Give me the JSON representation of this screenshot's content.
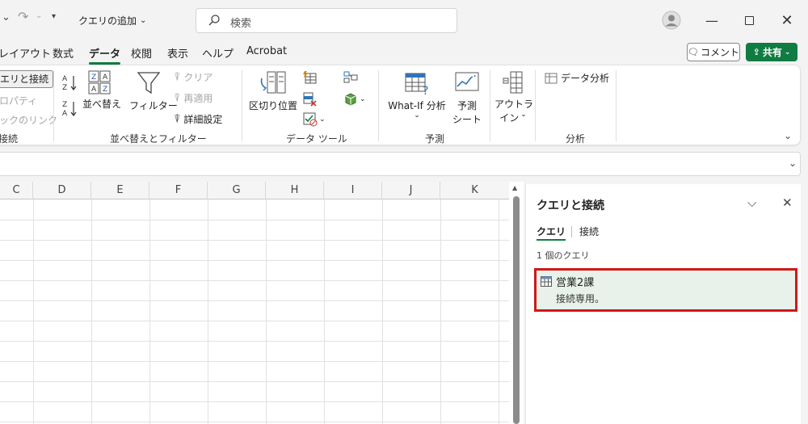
{
  "titlebar": {
    "doc_title": "クエリの追加",
    "search_placeholder": "検索"
  },
  "menu": {
    "tabs": [
      "レイアウト",
      "数式",
      "データ",
      "校閲",
      "表示",
      "ヘルプ",
      "Acrobat"
    ],
    "active_tab": "データ",
    "comment_label": "コメント",
    "share_label": "共有"
  },
  "ribbon": {
    "queries_group": {
      "label": "接続",
      "items": [
        "エリと接続",
        "ロパティ",
        "ックのリンク"
      ]
    },
    "sort_group": {
      "label": "並べ替えとフィルター",
      "sort_label": "並べ替え",
      "filter_label": "フィルター",
      "clear_label": "クリア",
      "reapply_label": "再適用",
      "advanced_label": "詳細設定"
    },
    "datatools_group": {
      "label": "データ ツール",
      "text_to_columns_label": "区切り位置"
    },
    "forecast_group": {
      "label": "予測",
      "whatif_label": "What-If 分析",
      "forecast_sheet_label": [
        "予測",
        "シート"
      ]
    },
    "outline_group": {
      "label": "",
      "outline_label": [
        "アウトラ",
        "イン"
      ]
    },
    "analysis_group": {
      "label": "分析",
      "data_analysis_label": "データ分析"
    }
  },
  "sheet": {
    "columns": [
      "C",
      "D",
      "E",
      "F",
      "G",
      "H",
      "I",
      "J",
      "K"
    ]
  },
  "pane": {
    "title": "クエリと接続",
    "tabs": [
      "クエリ",
      "接続"
    ],
    "active_tab": "クエリ",
    "count_text": "1 個のクエリ",
    "queries": [
      {
        "name": "営業2課",
        "status": "接続専用。"
      }
    ]
  },
  "colors": {
    "accent": "#107c41",
    "highlight_border": "#d01818",
    "query_bg": "#e8f2ea"
  }
}
